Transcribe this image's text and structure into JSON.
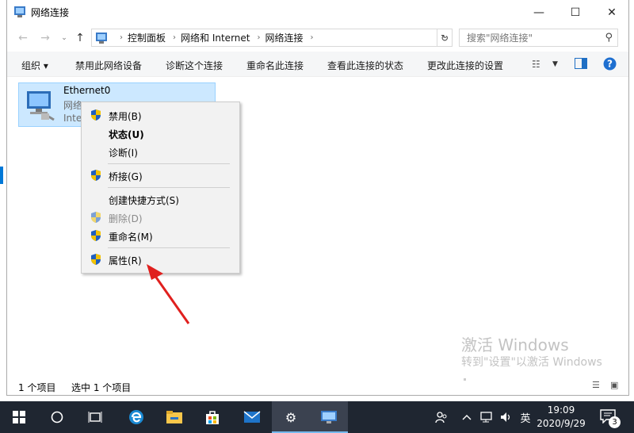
{
  "window": {
    "title": "网络连接"
  },
  "address": {
    "breadcrumbs": [
      "控制面板",
      "网络和 Internet",
      "网络连接"
    ],
    "search_placeholder": "搜索\"网络连接\""
  },
  "toolbar": {
    "organize": "组织",
    "disable": "禁用此网络设备",
    "diagnose": "诊断这个连接",
    "rename": "重命名此连接",
    "status": "查看此连接的状态",
    "change": "更改此连接的设置"
  },
  "item": {
    "name": "Ethernet0",
    "sub1": "网络",
    "sub2": "Inte"
  },
  "context_menu": {
    "disable": "禁用(B)",
    "status": "状态(U)",
    "diagnose": "诊断(I)",
    "bridge": "桥接(G)",
    "shortcut": "创建快捷方式(S)",
    "delete": "删除(D)",
    "rename": "重命名(M)",
    "properties": "属性(R)"
  },
  "watermark": {
    "line1": "激活 Windows",
    "line2": "转到\"设置\"以激活 Windows"
  },
  "statusbar": {
    "count": "1 个项目",
    "selected": "选中 1 个项目"
  },
  "taskbar": {
    "ime": "英",
    "time": "19:09",
    "date": "2020/9/29",
    "notifications": "3"
  },
  "colors": {
    "accent": "#0078d7",
    "selection": "#cce8ff",
    "taskbar": "#1f2631",
    "arrow": "#e0201e"
  }
}
